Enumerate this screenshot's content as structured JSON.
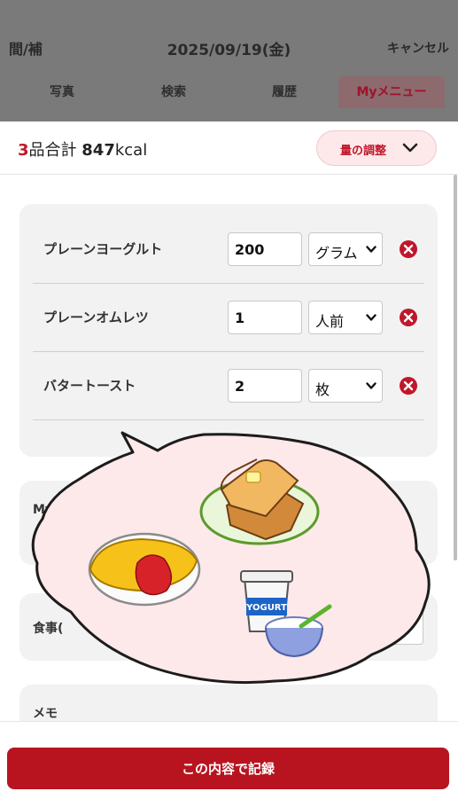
{
  "header": {
    "left_label": "間/補",
    "date": "2025/09/19(金)",
    "cancel_label": "キャンセル",
    "tabs": [
      {
        "label": "写真",
        "active": false
      },
      {
        "label": "検索",
        "active": false
      },
      {
        "label": "履歴",
        "active": false
      },
      {
        "label": "Myメニュー",
        "active": true
      }
    ]
  },
  "summary": {
    "count": "3",
    "count_suffix": "品合計",
    "kcal": "847",
    "kcal_unit": "kcal",
    "adjust_label": "量の調整",
    "adjust_icon": "chevron-down-icon"
  },
  "items": [
    {
      "name": "プレーンヨーグルト",
      "quantity": "200",
      "unit": "グラム"
    },
    {
      "name": "プレーンオムレツ",
      "quantity": "1",
      "unit": "人前"
    },
    {
      "name": "バタートースト",
      "quantity": "2",
      "unit": "枚"
    }
  ],
  "sections": {
    "mymenu_label": "My",
    "meal_label": "食事(",
    "memo_label": "メモ"
  },
  "footer": {
    "record_label": "この内容で記録"
  },
  "illustration": {
    "yogurt_text": "YOGURT"
  },
  "colors": {
    "accent": "#c0172b",
    "button": "#b8141f",
    "header_overlay": "#7a7a7a",
    "bubble": "#fde8ea"
  }
}
